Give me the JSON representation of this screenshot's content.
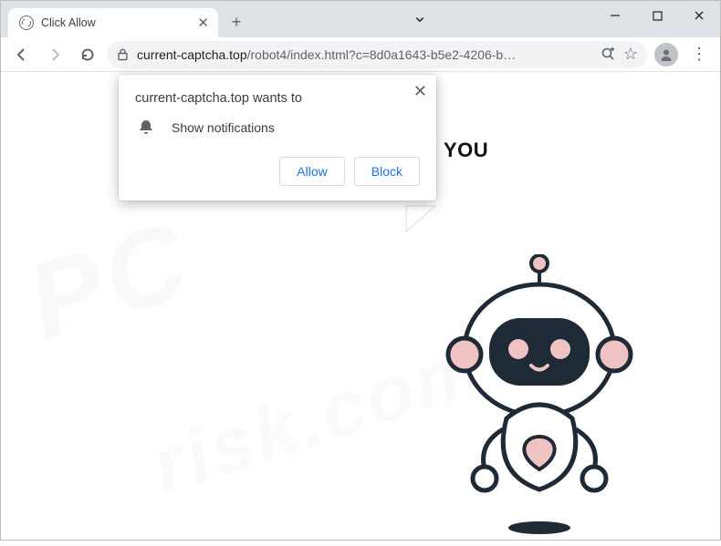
{
  "window": {
    "tab_title": "Click Allow",
    "url_host": "current-captcha.top",
    "url_path": "/robot4/index.html?c=8d0a1643-b5e2-4206-b…"
  },
  "page": {
    "headline_fragment": "YOU"
  },
  "permission_prompt": {
    "origin_line": "current-captcha.top wants to",
    "capability": "Show notifications",
    "allow_label": "Allow",
    "block_label": "Block"
  },
  "icons": {
    "chevron": "⌄",
    "minimize": "—",
    "maximize": "☐",
    "close": "✕",
    "tab_close": "✕",
    "plus": "+",
    "menu_dots": "⋮",
    "star": "☆",
    "search": "⊕"
  },
  "watermark": {
    "line1": "PC",
    "line2": "risk.com"
  }
}
